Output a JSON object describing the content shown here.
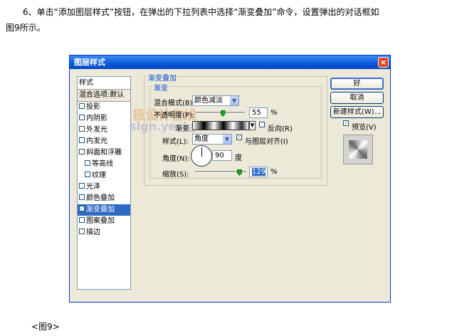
{
  "intro": {
    "line1": "6、单击“添加图层样式”按钮，在弹出的下拉列表中选择“渐变叠加”命令，设置弹出的对话框如",
    "line2": "图9所示。"
  },
  "caption": "<图9>",
  "dialog": {
    "title": "图层样式",
    "close_glyph": "×",
    "style_list": {
      "header": "样式",
      "blend_options": "混合选项:默认",
      "items": [
        {
          "label": "投影",
          "checked": false,
          "sub": false
        },
        {
          "label": "内阴影",
          "checked": false,
          "sub": false
        },
        {
          "label": "外发光",
          "checked": false,
          "sub": false
        },
        {
          "label": "内发光",
          "checked": false,
          "sub": false
        },
        {
          "label": "斜面和浮雕",
          "checked": false,
          "sub": false
        },
        {
          "label": "等高线",
          "checked": false,
          "sub": true
        },
        {
          "label": "纹理",
          "checked": false,
          "sub": true
        },
        {
          "label": "光泽",
          "checked": false,
          "sub": false
        },
        {
          "label": "颜色叠加",
          "checked": false,
          "sub": false
        },
        {
          "label": "渐变叠加",
          "checked": true,
          "sub": false,
          "selected": true
        },
        {
          "label": "图案叠加",
          "checked": false,
          "sub": false
        },
        {
          "label": "描边",
          "checked": false,
          "sub": false
        }
      ]
    },
    "panel": {
      "group_title": "渐变叠加",
      "inner_title": "渐变",
      "blend_mode_label": "混合模式(B):",
      "blend_mode_value": "颜色减淡",
      "opacity_label": "不透明度(P):",
      "opacity_value": "55",
      "opacity_unit": "%",
      "opacity_fraction": 0.55,
      "gradient_label": "渐变:",
      "reverse_label": "反向(R)",
      "reverse_checked": false,
      "style_label": "样式(L):",
      "style_value": "角度",
      "align_label": "与图层对齐(I)",
      "align_checked": true,
      "angle_label": "角度(N):",
      "angle_value": "90",
      "angle_unit": "度",
      "scale_label": "缩放(S):",
      "scale_value": "129",
      "scale_unit": "%",
      "scale_fraction": 0.86
    },
    "buttons": {
      "ok": "好",
      "cancel": "取消",
      "new_style": "新建样式(W)...",
      "preview_label": "预览(V)",
      "preview_checked": true
    }
  },
  "watermark": {
    "line1": "天极设计在线",
    "line2": "Design.yesky.com"
  },
  "colors": {
    "title_bar": "#0a58d8",
    "selection": "#316ac5",
    "dialog_bg": "#ece9d8",
    "check_green": "#21a121"
  }
}
